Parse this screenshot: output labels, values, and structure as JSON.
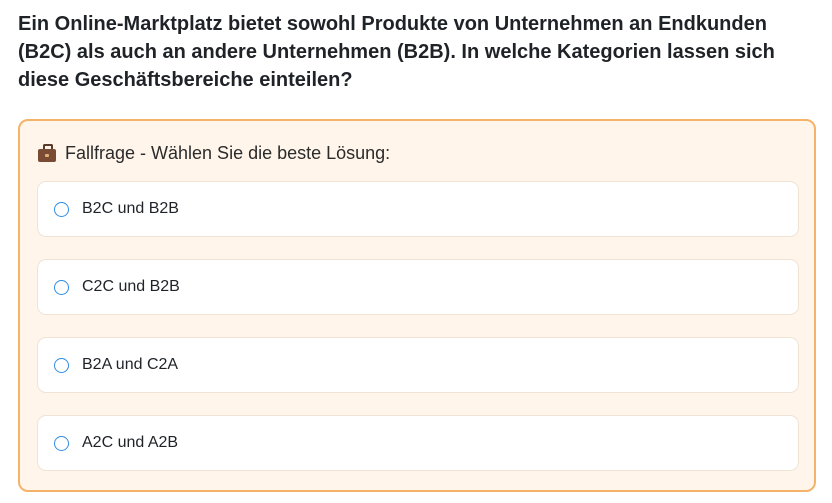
{
  "question": "Ein Online-Marktplatz bietet sowohl Produkte von Unternehmen an Endkunden (B2C) als auch an andere Unternehmen (B2B). In welche Kategorien lassen sich diese Geschäftsbereiche einteilen?",
  "case": {
    "icon": "briefcase-icon",
    "label": "Fallfrage - Wählen Sie die beste Lösung:"
  },
  "options": [
    {
      "label": "B2C und B2B",
      "selected": false
    },
    {
      "label": "C2C und B2B",
      "selected": false
    },
    {
      "label": "B2A und C2A",
      "selected": false
    },
    {
      "label": "A2C und A2B",
      "selected": false
    }
  ],
  "colors": {
    "accent": "#2f8de4",
    "box_border": "#f5b36a",
    "box_background": "#fff5eb"
  }
}
